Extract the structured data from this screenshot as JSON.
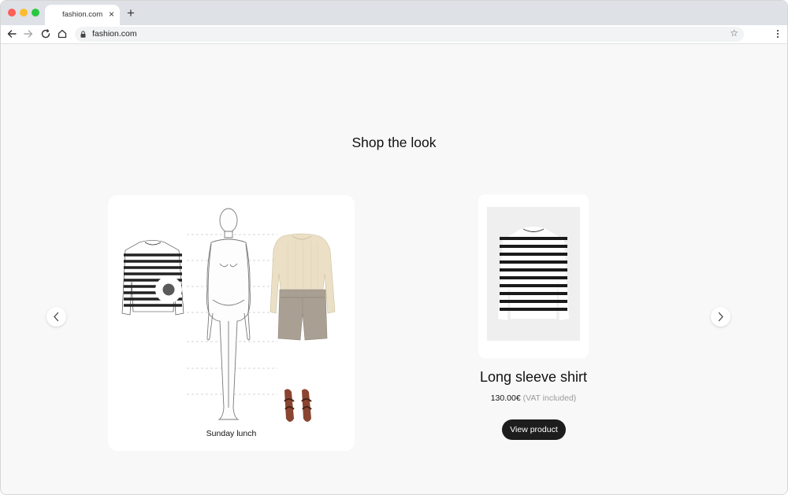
{
  "browser": {
    "tab_title": "fashion.com",
    "tab_close": "×",
    "new_tab": "+",
    "url": "fashion.com",
    "bookmark_star": "☆"
  },
  "page": {
    "heading": "Shop the look",
    "look": {
      "caption": "Sunday lunch",
      "items": [
        "striped-shirt",
        "cream-sweater",
        "linen-shorts",
        "sandals"
      ]
    },
    "product": {
      "name": "Long sleeve shirt",
      "price": "130.00€",
      "vat": "(VAT included)",
      "cta": "View product"
    }
  },
  "colors": {
    "accent_button": "#1d1d1d",
    "background": "#f8f8f8",
    "card": "#ffffff"
  }
}
